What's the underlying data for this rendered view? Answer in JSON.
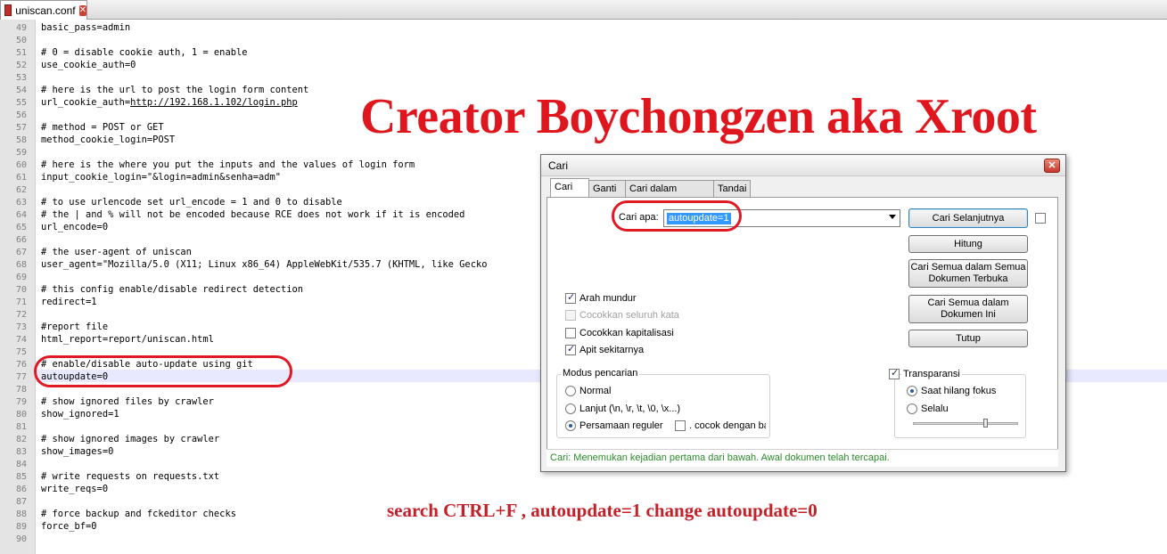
{
  "tab": {
    "label": "uniscan.conf",
    "close": "✕"
  },
  "code": [
    {
      "n": "49",
      "t": "basic_pass=admin"
    },
    {
      "n": "50",
      "t": ""
    },
    {
      "n": "51",
      "t": "# 0 = disable cookie auth, 1 = enable"
    },
    {
      "n": "52",
      "t": "use_cookie_auth=0"
    },
    {
      "n": "53",
      "t": ""
    },
    {
      "n": "54",
      "t": "# here is the url to post the login form content"
    },
    {
      "n": "55",
      "t": "url_cookie_auth=",
      "link": "http://192.168.1.102/login.php"
    },
    {
      "n": "56",
      "t": ""
    },
    {
      "n": "57",
      "t": "# method = POST or GET"
    },
    {
      "n": "58",
      "t": "method_cookie_login=POST"
    },
    {
      "n": "59",
      "t": ""
    },
    {
      "n": "60",
      "t": "# here is the where you put the inputs and the values of login form"
    },
    {
      "n": "61",
      "t": "input_cookie_login=\"&login=admin&senha=adm\""
    },
    {
      "n": "62",
      "t": ""
    },
    {
      "n": "63",
      "t": "# to use urlencode set url_encode = 1 and 0 to disable"
    },
    {
      "n": "64",
      "t": "# the | and % will not be encoded because RCE does not work if it is encoded"
    },
    {
      "n": "65",
      "t": "url_encode=0"
    },
    {
      "n": "66",
      "t": ""
    },
    {
      "n": "67",
      "t": "# the user-agent of uniscan"
    },
    {
      "n": "68",
      "t": "user_agent=\"Mozilla/5.0 (X11; Linux x86_64) AppleWebKit/535.7 (KHTML, like Gecko"
    },
    {
      "n": "69",
      "t": ""
    },
    {
      "n": "70",
      "t": "# this config enable/disable redirect detection"
    },
    {
      "n": "71",
      "t": "redirect=1"
    },
    {
      "n": "72",
      "t": ""
    },
    {
      "n": "73",
      "t": "#report file"
    },
    {
      "n": "74",
      "t": "html_report=report/uniscan.html"
    },
    {
      "n": "75",
      "t": ""
    },
    {
      "n": "76",
      "t": "# enable/disable auto-update using git"
    },
    {
      "n": "77",
      "t": "autoupdate=0"
    },
    {
      "n": "78",
      "t": ""
    },
    {
      "n": "79",
      "t": "# show ignored files by crawler"
    },
    {
      "n": "80",
      "t": "show_ignored=1"
    },
    {
      "n": "81",
      "t": ""
    },
    {
      "n": "82",
      "t": "# show ignored images by crawler"
    },
    {
      "n": "83",
      "t": "show_images=0"
    },
    {
      "n": "84",
      "t": ""
    },
    {
      "n": "85",
      "t": "# write requests on requests.txt"
    },
    {
      "n": "86",
      "t": "write_reqs=0"
    },
    {
      "n": "87",
      "t": ""
    },
    {
      "n": "88",
      "t": "# force backup and fckeditor checks"
    },
    {
      "n": "89",
      "t": "force_bf=0"
    },
    {
      "n": "90",
      "t": ""
    }
  ],
  "annotations": {
    "title": "Creator Boychongzen aka Xroot",
    "note": "search CTRL+F , autoupdate=1 change autoupdate=0",
    "color": "#e0161e"
  },
  "dialog": {
    "title": "Cari",
    "close": "✕",
    "tabs": [
      "Cari",
      "Ganti",
      "Cari dalam Berkas",
      "Tandai"
    ],
    "find_label": "Cari apa:",
    "find_value": "autoupdate=1",
    "buttons": {
      "find_next": "Cari Selanjutnya",
      "count": "Hitung",
      "find_all_open_1": "Cari Semua dalam Semua",
      "find_all_open_2": "Dokumen Terbuka",
      "find_all_current_1": "Cari Semua dalam",
      "find_all_current_2": "Dokumen Ini",
      "close": "Tutup"
    },
    "options": {
      "backward": "Arah mundur",
      "whole_word": "Cocokkan seluruh kata",
      "match_case": "Cocokkan kapitalisasi",
      "wrap": "Apit sekitarnya"
    },
    "search_mode": {
      "title": "Modus pencarian",
      "normal": "Normal",
      "extended": "Lanjut (\\n, \\r, \\t, \\0, \\x...)",
      "regex": "Persamaan reguler",
      "dot_matches": ". cocok dengan ba"
    },
    "transparency": {
      "title": "Transparansi",
      "on_lose_focus": "Saat hilang fokus",
      "always": "Selalu",
      "level": 0.7
    },
    "status": "Cari: Menemukan kejadian pertama dari bawah. Awal dokumen telah tercapai."
  }
}
